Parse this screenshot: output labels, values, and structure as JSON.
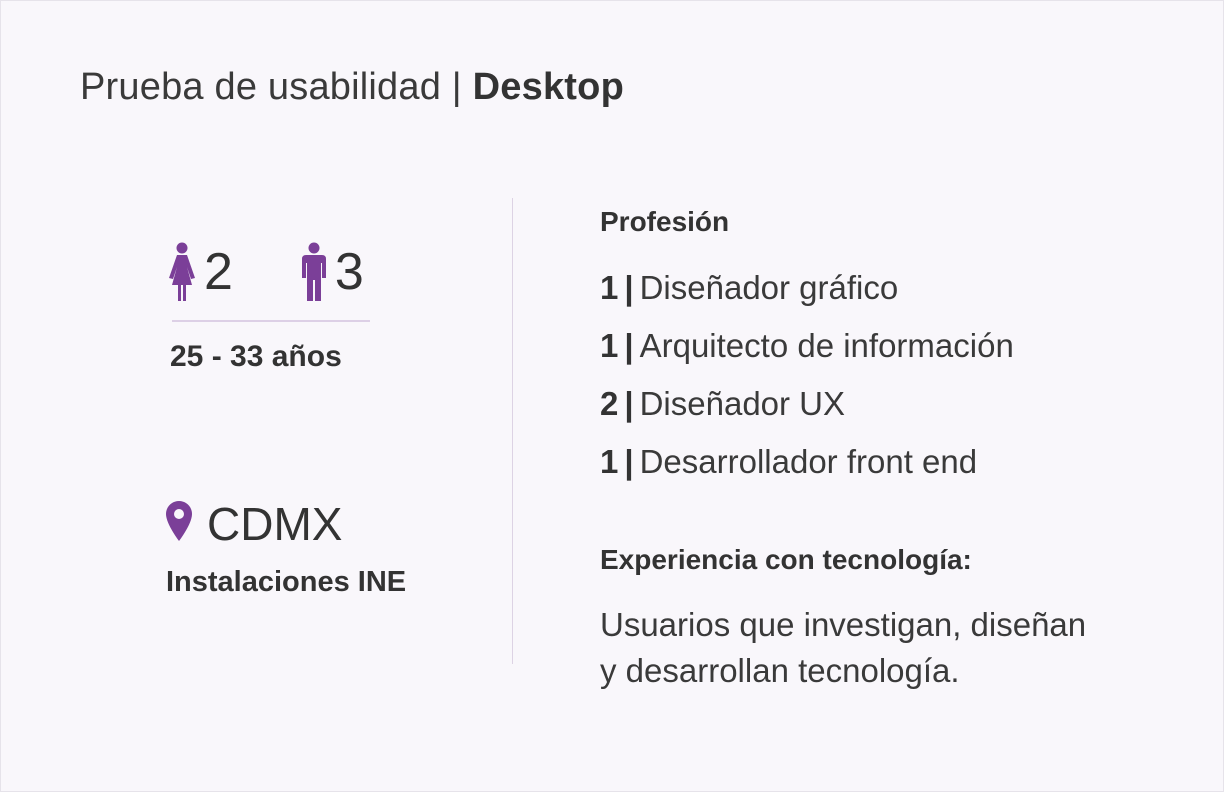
{
  "title": {
    "light": "Prueba de usabilidad |",
    "bold": "Desktop"
  },
  "participants": {
    "female_count": "2",
    "male_count": "3",
    "age_range": "25 - 33 años"
  },
  "location": {
    "city": "CDMX",
    "venue": "Instalaciones INE"
  },
  "profession": {
    "heading": "Profesión",
    "items": [
      {
        "count": "1",
        "separator": "|",
        "label": "Diseñador gráfico"
      },
      {
        "count": "1",
        "separator": "|",
        "label": "Arquitecto de información"
      },
      {
        "count": "2",
        "separator": "|",
        "label": "Diseñador UX"
      },
      {
        "count": "1",
        "separator": "|",
        "label": "Desarrollador front end"
      }
    ]
  },
  "experience": {
    "heading": "Experiencia con tecnología:",
    "line1": "Usuarios que investigan, diseñan",
    "line2": "y desarrollan tecnología."
  },
  "colors": {
    "accent": "#7b3f98",
    "divider": "#ddd3e4",
    "background": "#f9f7fb",
    "text": "#333333"
  },
  "icons": {
    "female": "female-person-icon",
    "male": "male-person-icon",
    "location": "map-pin-icon"
  }
}
